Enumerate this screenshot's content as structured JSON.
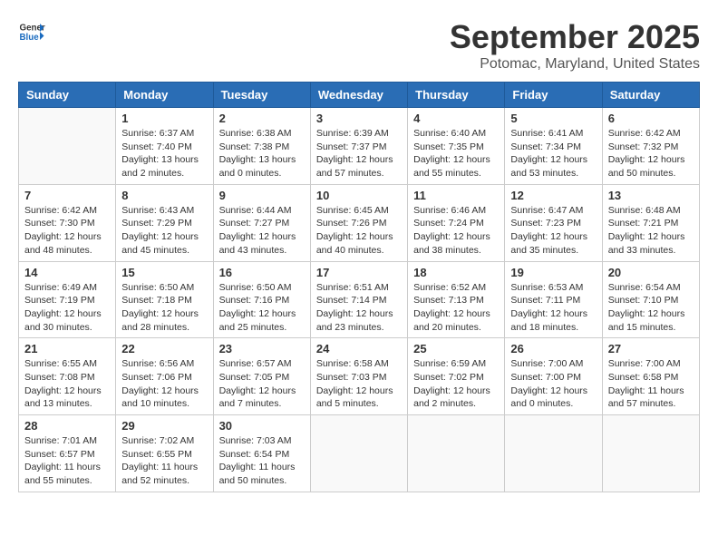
{
  "logo": {
    "line1": "General",
    "line2": "Blue"
  },
  "title": "September 2025",
  "subtitle": "Potomac, Maryland, United States",
  "weekdays": [
    "Sunday",
    "Monday",
    "Tuesday",
    "Wednesday",
    "Thursday",
    "Friday",
    "Saturday"
  ],
  "weeks": [
    [
      {
        "day": "",
        "sunrise": "",
        "sunset": "",
        "daylight": ""
      },
      {
        "day": "1",
        "sunrise": "Sunrise: 6:37 AM",
        "sunset": "Sunset: 7:40 PM",
        "daylight": "Daylight: 13 hours and 2 minutes."
      },
      {
        "day": "2",
        "sunrise": "Sunrise: 6:38 AM",
        "sunset": "Sunset: 7:38 PM",
        "daylight": "Daylight: 13 hours and 0 minutes."
      },
      {
        "day": "3",
        "sunrise": "Sunrise: 6:39 AM",
        "sunset": "Sunset: 7:37 PM",
        "daylight": "Daylight: 12 hours and 57 minutes."
      },
      {
        "day": "4",
        "sunrise": "Sunrise: 6:40 AM",
        "sunset": "Sunset: 7:35 PM",
        "daylight": "Daylight: 12 hours and 55 minutes."
      },
      {
        "day": "5",
        "sunrise": "Sunrise: 6:41 AM",
        "sunset": "Sunset: 7:34 PM",
        "daylight": "Daylight: 12 hours and 53 minutes."
      },
      {
        "day": "6",
        "sunrise": "Sunrise: 6:42 AM",
        "sunset": "Sunset: 7:32 PM",
        "daylight": "Daylight: 12 hours and 50 minutes."
      }
    ],
    [
      {
        "day": "7",
        "sunrise": "Sunrise: 6:42 AM",
        "sunset": "Sunset: 7:30 PM",
        "daylight": "Daylight: 12 hours and 48 minutes."
      },
      {
        "day": "8",
        "sunrise": "Sunrise: 6:43 AM",
        "sunset": "Sunset: 7:29 PM",
        "daylight": "Daylight: 12 hours and 45 minutes."
      },
      {
        "day": "9",
        "sunrise": "Sunrise: 6:44 AM",
        "sunset": "Sunset: 7:27 PM",
        "daylight": "Daylight: 12 hours and 43 minutes."
      },
      {
        "day": "10",
        "sunrise": "Sunrise: 6:45 AM",
        "sunset": "Sunset: 7:26 PM",
        "daylight": "Daylight: 12 hours and 40 minutes."
      },
      {
        "day": "11",
        "sunrise": "Sunrise: 6:46 AM",
        "sunset": "Sunset: 7:24 PM",
        "daylight": "Daylight: 12 hours and 38 minutes."
      },
      {
        "day": "12",
        "sunrise": "Sunrise: 6:47 AM",
        "sunset": "Sunset: 7:23 PM",
        "daylight": "Daylight: 12 hours and 35 minutes."
      },
      {
        "day": "13",
        "sunrise": "Sunrise: 6:48 AM",
        "sunset": "Sunset: 7:21 PM",
        "daylight": "Daylight: 12 hours and 33 minutes."
      }
    ],
    [
      {
        "day": "14",
        "sunrise": "Sunrise: 6:49 AM",
        "sunset": "Sunset: 7:19 PM",
        "daylight": "Daylight: 12 hours and 30 minutes."
      },
      {
        "day": "15",
        "sunrise": "Sunrise: 6:50 AM",
        "sunset": "Sunset: 7:18 PM",
        "daylight": "Daylight: 12 hours and 28 minutes."
      },
      {
        "day": "16",
        "sunrise": "Sunrise: 6:50 AM",
        "sunset": "Sunset: 7:16 PM",
        "daylight": "Daylight: 12 hours and 25 minutes."
      },
      {
        "day": "17",
        "sunrise": "Sunrise: 6:51 AM",
        "sunset": "Sunset: 7:14 PM",
        "daylight": "Daylight: 12 hours and 23 minutes."
      },
      {
        "day": "18",
        "sunrise": "Sunrise: 6:52 AM",
        "sunset": "Sunset: 7:13 PM",
        "daylight": "Daylight: 12 hours and 20 minutes."
      },
      {
        "day": "19",
        "sunrise": "Sunrise: 6:53 AM",
        "sunset": "Sunset: 7:11 PM",
        "daylight": "Daylight: 12 hours and 18 minutes."
      },
      {
        "day": "20",
        "sunrise": "Sunrise: 6:54 AM",
        "sunset": "Sunset: 7:10 PM",
        "daylight": "Daylight: 12 hours and 15 minutes."
      }
    ],
    [
      {
        "day": "21",
        "sunrise": "Sunrise: 6:55 AM",
        "sunset": "Sunset: 7:08 PM",
        "daylight": "Daylight: 12 hours and 13 minutes."
      },
      {
        "day": "22",
        "sunrise": "Sunrise: 6:56 AM",
        "sunset": "Sunset: 7:06 PM",
        "daylight": "Daylight: 12 hours and 10 minutes."
      },
      {
        "day": "23",
        "sunrise": "Sunrise: 6:57 AM",
        "sunset": "Sunset: 7:05 PM",
        "daylight": "Daylight: 12 hours and 7 minutes."
      },
      {
        "day": "24",
        "sunrise": "Sunrise: 6:58 AM",
        "sunset": "Sunset: 7:03 PM",
        "daylight": "Daylight: 12 hours and 5 minutes."
      },
      {
        "day": "25",
        "sunrise": "Sunrise: 6:59 AM",
        "sunset": "Sunset: 7:02 PM",
        "daylight": "Daylight: 12 hours and 2 minutes."
      },
      {
        "day": "26",
        "sunrise": "Sunrise: 7:00 AM",
        "sunset": "Sunset: 7:00 PM",
        "daylight": "Daylight: 12 hours and 0 minutes."
      },
      {
        "day": "27",
        "sunrise": "Sunrise: 7:00 AM",
        "sunset": "Sunset: 6:58 PM",
        "daylight": "Daylight: 11 hours and 57 minutes."
      }
    ],
    [
      {
        "day": "28",
        "sunrise": "Sunrise: 7:01 AM",
        "sunset": "Sunset: 6:57 PM",
        "daylight": "Daylight: 11 hours and 55 minutes."
      },
      {
        "day": "29",
        "sunrise": "Sunrise: 7:02 AM",
        "sunset": "Sunset: 6:55 PM",
        "daylight": "Daylight: 11 hours and 52 minutes."
      },
      {
        "day": "30",
        "sunrise": "Sunrise: 7:03 AM",
        "sunset": "Sunset: 6:54 PM",
        "daylight": "Daylight: 11 hours and 50 minutes."
      },
      {
        "day": "",
        "sunrise": "",
        "sunset": "",
        "daylight": ""
      },
      {
        "day": "",
        "sunrise": "",
        "sunset": "",
        "daylight": ""
      },
      {
        "day": "",
        "sunrise": "",
        "sunset": "",
        "daylight": ""
      },
      {
        "day": "",
        "sunrise": "",
        "sunset": "",
        "daylight": ""
      }
    ]
  ]
}
